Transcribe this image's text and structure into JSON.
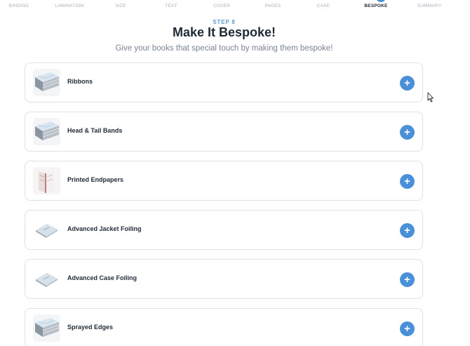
{
  "steps": [
    {
      "label": "BINDING",
      "active": false
    },
    {
      "label": "LAMINATION",
      "active": false
    },
    {
      "label": "SIZE",
      "active": false
    },
    {
      "label": "TEXT",
      "active": false
    },
    {
      "label": "COVER",
      "active": false
    },
    {
      "label": "PAGES",
      "active": false
    },
    {
      "label": "CASE",
      "active": false
    },
    {
      "label": "BESPOKE",
      "active": true
    },
    {
      "label": "SUMMARY",
      "active": false
    }
  ],
  "header": {
    "step_label": "STEP 8",
    "title": "Make It Bespoke!",
    "subtitle": "Give your books that special touch by making them bespoke!"
  },
  "options": [
    {
      "label": "Ribbons",
      "icon": "book-stack-icon"
    },
    {
      "label": "Head & Tail Bands",
      "icon": "book-stack-icon"
    },
    {
      "label": "Printed Endpapers",
      "icon": "open-book-icon"
    },
    {
      "label": "Advanced Jacket Foiling",
      "icon": "flat-book-icon"
    },
    {
      "label": "Advanced Case Foiling",
      "icon": "flat-book-icon"
    },
    {
      "label": "Sprayed Edges",
      "icon": "book-stack-icon"
    }
  ],
  "add_button_symbol": "+",
  "colors": {
    "accent": "#4a90d9",
    "text": "#1f2a37",
    "muted": "#a9b1bb",
    "border": "#dfe3e8"
  }
}
